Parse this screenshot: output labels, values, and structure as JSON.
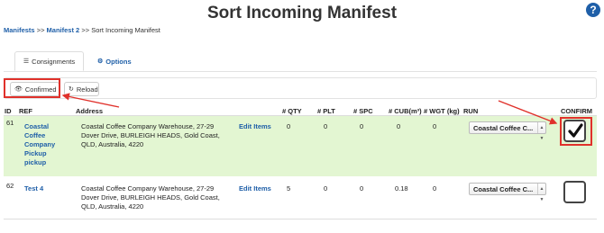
{
  "header": {
    "title": "Sort Incoming Manifest",
    "help_glyph": "?"
  },
  "breadcrumb": {
    "items": [
      "Manifests",
      "Manifest 2",
      "Sort Incoming Manifest"
    ],
    "separator": ">>"
  },
  "tabs": [
    {
      "label": "Consignments",
      "icon": "list-icon",
      "active": true
    },
    {
      "label": "Options",
      "icon": "gear-icon",
      "active": false
    }
  ],
  "toolbar": {
    "confirmed_label": "Confirmed",
    "confirmed_icon": "eye-icon",
    "reload_label": "Reload",
    "reload_icon": "refresh-icon"
  },
  "table": {
    "columns": [
      "ID",
      "REF",
      "Address",
      "# QTY",
      "# PLT",
      "# SPC",
      "# CUB(m³)",
      "# WGT (kg)",
      "RUN",
      "CONFIRM"
    ],
    "rows": [
      {
        "id": "61",
        "ref_lines": [
          "Coastal",
          "Coffee",
          "Company",
          "Pickup",
          "pickup"
        ],
        "address_lines": [
          "Coastal Coffee Company Warehouse, 27-29",
          "Dover Drive, BURLEIGH HEADS, Gold Coast,",
          "QLD, Australia, 4220"
        ],
        "edit_label": "Edit Items",
        "qty": "0",
        "plt": "0",
        "spc": "0",
        "cub": "0",
        "wgt": "0",
        "run": "Coastal Coffee C...",
        "confirmed": true,
        "highlight_color": "#e3f6d2"
      },
      {
        "id": "62",
        "ref_lines": [
          "Test 4"
        ],
        "address_lines": [
          "Coastal Coffee Company Warehouse, 27-29",
          "Dover Drive, BURLEIGH HEADS, Gold Coast,",
          "QLD, Australia, 4220"
        ],
        "edit_label": "Edit Items",
        "qty": "5",
        "plt": "0",
        "spc": "0",
        "cub": "0.18",
        "wgt": "0",
        "run": "Coastal Coffee C...",
        "confirmed": false
      }
    ]
  },
  "colors": {
    "accent": "#1f5fa8",
    "annotation": "#e0312b",
    "confirmed_row": "#e3f6d2"
  }
}
